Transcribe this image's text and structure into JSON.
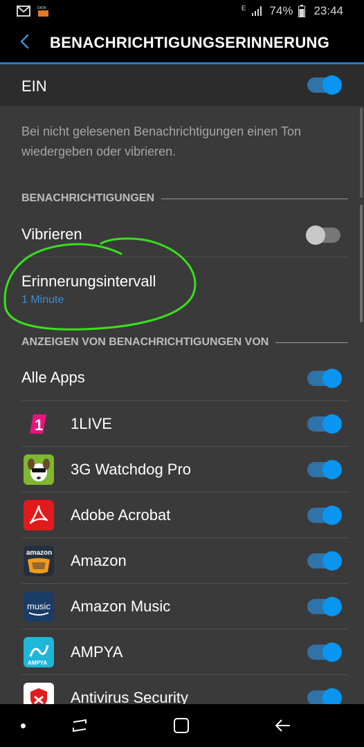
{
  "status_bar": {
    "battery": "74%",
    "time": "23:44",
    "icons": [
      "mail-icon",
      "data-icon",
      "network-e-icon",
      "signal-icon",
      "battery-icon"
    ]
  },
  "header": {
    "title": "BENACHRICHTIGUNGSERINNERUNG"
  },
  "master": {
    "label": "EIN",
    "on": true
  },
  "description": "Bei nicht gelesenen Benachrichtigungen einen Ton wiedergeben oder vibrieren.",
  "notifications": {
    "section": "BENACHRICHTIGUNGEN",
    "vibrate": {
      "label": "Vibrieren",
      "on": false
    },
    "interval": {
      "label": "Erinnerungsintervall",
      "value": "1 Minute"
    }
  },
  "apps": {
    "section": "ANZEIGEN VON BENACHRICHTIGUNGEN VON",
    "all": {
      "label": "Alle Apps",
      "on": true
    },
    "items": [
      {
        "name": "1LIVE",
        "icon": "1live-icon",
        "on": true
      },
      {
        "name": "3G Watchdog Pro",
        "icon": "watchdog-icon",
        "on": true
      },
      {
        "name": "Adobe Acrobat",
        "icon": "acrobat-icon",
        "on": true
      },
      {
        "name": "Amazon",
        "icon": "amazon-icon",
        "on": true
      },
      {
        "name": "Amazon Music",
        "icon": "amazon-music-icon",
        "on": true
      },
      {
        "name": "AMPYA",
        "icon": "ampya-icon",
        "on": true
      },
      {
        "name": "Antivirus Security",
        "icon": "antivirus-icon",
        "on": true
      }
    ]
  },
  "icon_texts": {
    "amazon": "amazon",
    "amazon_music": "music",
    "ampya": "AMPYA",
    "data": "DATA",
    "one": "1"
  },
  "colors": {
    "accent": "#0a95f0",
    "header_underline": "#2a79c6",
    "link": "#3a8fd6",
    "annotation": "#39e01b"
  }
}
